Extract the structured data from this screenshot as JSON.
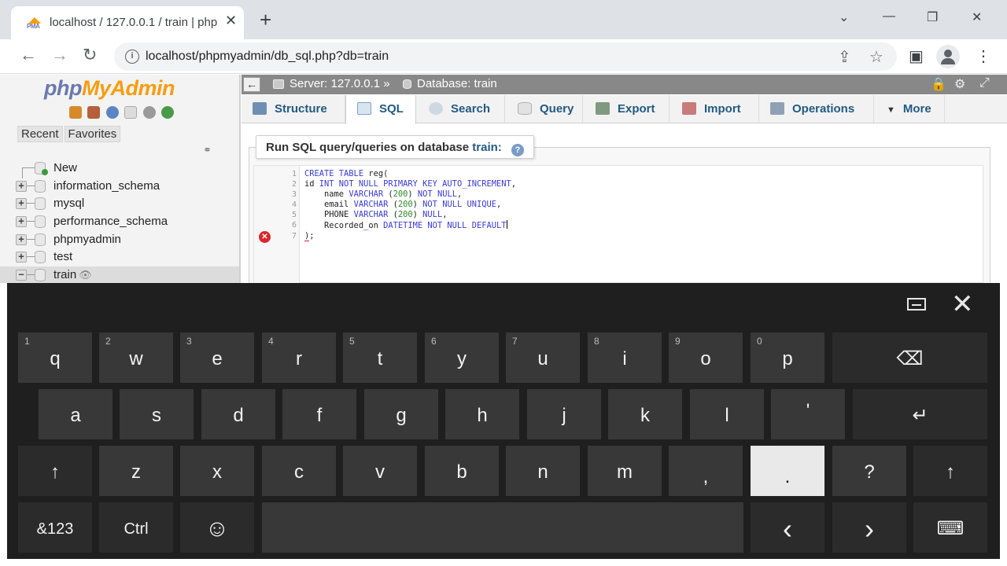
{
  "browser": {
    "tab_title": "localhost / 127.0.0.1 / train | php",
    "favicon_text": "PMA",
    "tab_close": "✕",
    "new_tab": "+",
    "url": "localhost/phpmyadmin/db_sql.php?db=train",
    "icons": {
      "back": "←",
      "forward": "→",
      "reload": "↻",
      "info": "i",
      "share": "⇪",
      "star": "☆",
      "sidebar": "▣",
      "menu": "⋮",
      "minimize": "—",
      "restore": "❐",
      "close": "✕",
      "tablist": "⌄"
    }
  },
  "pma": {
    "logo_part1": "php",
    "logo_part2": "MyAdmin",
    "recent_tab": "Recent",
    "favorites_tab": "Favorites",
    "new_item": "New",
    "databases": [
      "information_schema",
      "mysql",
      "performance_schema",
      "phpmyadmin",
      "test",
      "train"
    ],
    "expander_plus": "+",
    "expander_minus": "−",
    "breadcrumb_server": "Server: 127.0.0.1 »",
    "breadcrumb_database": "Database: train",
    "collapse": "←",
    "tabs": [
      "Structure",
      "SQL",
      "Search",
      "Query",
      "Export",
      "Import",
      "Operations",
      "More"
    ],
    "more_arrow": "▼",
    "legend_prefix": "Run SQL query/queries on database",
    "legend_db": "train:",
    "help": "?",
    "error_marker": "✕",
    "line_numbers": [
      "1",
      "2",
      "3",
      "4",
      "5",
      "6",
      "7"
    ]
  },
  "sql": {
    "l1_a": "CREATE TABLE",
    "l1_b": " reg(",
    "l2_a": "id ",
    "l2_b": "INT NOT NULL PRIMARY KEY AUTO_INCREMENT",
    "l2_c": ",",
    "l3_a": "    name ",
    "l3_b": "VARCHAR",
    "l3_c": " (",
    "l3_d": "200",
    "l3_e": ") ",
    "l3_f": "NOT NULL",
    "l3_g": ",",
    "l4_a": "    email ",
    "l4_b": "VARCHAR",
    "l4_c": " (",
    "l4_d": "200",
    "l4_e": ") ",
    "l4_f": "NOT NULL UNIQUE",
    "l4_g": ",",
    "l5_a": "    PHONE ",
    "l5_b": "VARCHAR",
    "l5_c": " (",
    "l5_d": "200",
    "l5_e": ") ",
    "l5_f": "NULL",
    "l5_g": ",",
    "l6_a": "    Recorded_on ",
    "l6_b": "DATETIME NOT NULL DEFAULT",
    "l7_a": ")",
    "l7_b": ";"
  },
  "keyboard": {
    "row1": [
      {
        "label": "q",
        "hint": "1"
      },
      {
        "label": "w",
        "hint": "2"
      },
      {
        "label": "e",
        "hint": "3"
      },
      {
        "label": "r",
        "hint": "4"
      },
      {
        "label": "t",
        "hint": "5"
      },
      {
        "label": "y",
        "hint": "6"
      },
      {
        "label": "u",
        "hint": "7"
      },
      {
        "label": "i",
        "hint": "8"
      },
      {
        "label": "o",
        "hint": "9"
      },
      {
        "label": "p",
        "hint": "0"
      }
    ],
    "backspace": "⌫",
    "row2": [
      "a",
      "s",
      "d",
      "f",
      "g",
      "h",
      "j",
      "k",
      "l",
      "'"
    ],
    "enter": "↵",
    "row3": [
      "z",
      "x",
      "c",
      "v",
      "b",
      "n",
      "m",
      ",",
      ".",
      "?"
    ],
    "shift": "↑",
    "num": "&123",
    "ctrl": "Ctrl",
    "emoji": "☺",
    "left": "‹",
    "right": "›",
    "layout": "⌨",
    "close": "✕"
  },
  "colors": {
    "pma_blue": "#235a81",
    "pma_orange": "#f89c0e",
    "keyboard_bg": "#1f1f1f",
    "key_bg": "#383838",
    "key_hover": "#e9e9e9"
  }
}
